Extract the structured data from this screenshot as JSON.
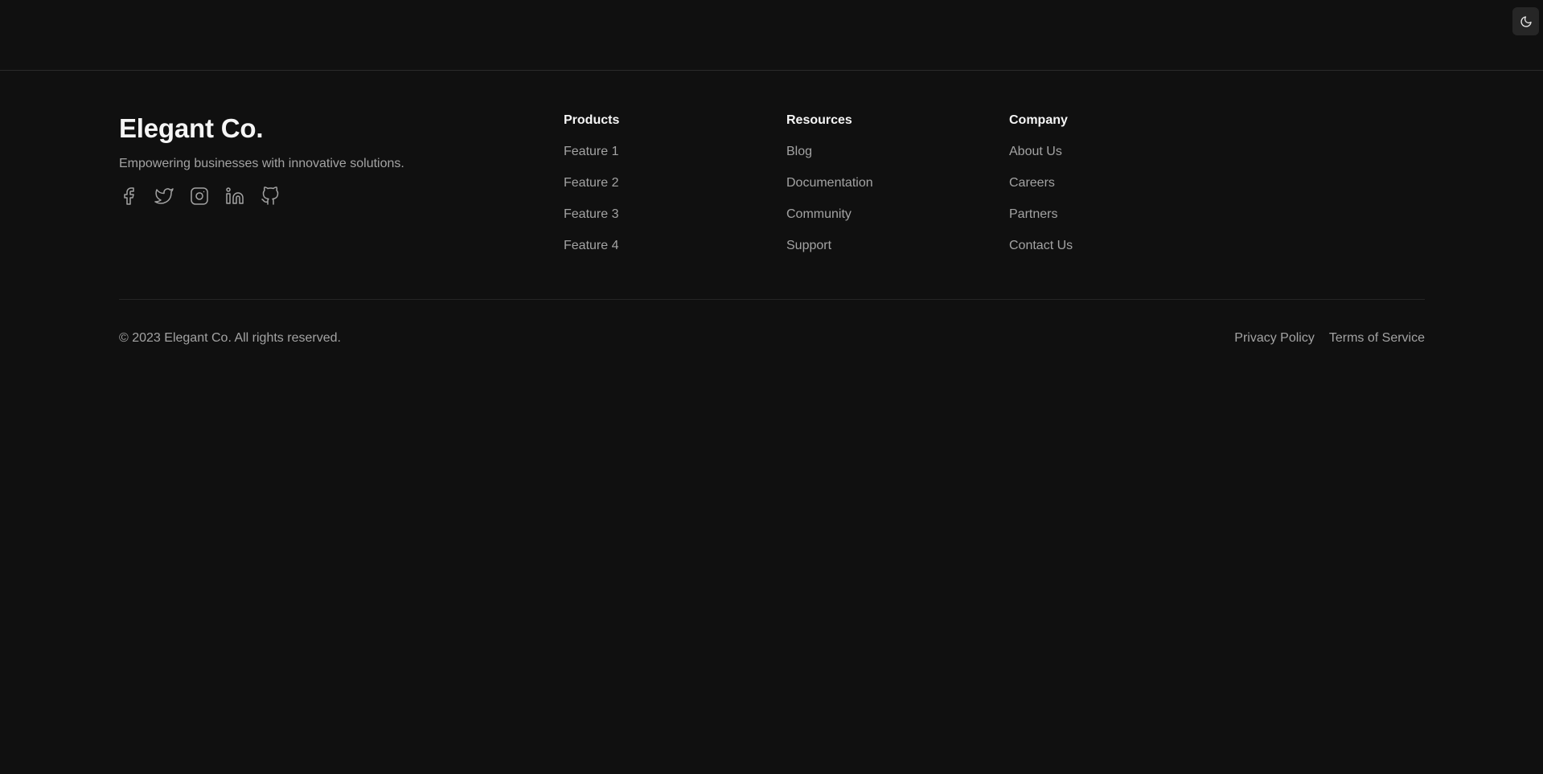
{
  "header": {
    "theme_toggle_icon": "moon-icon"
  },
  "brand": {
    "name": "Elegant Co.",
    "tagline": "Empowering businesses with innovative solutions.",
    "social_icons": [
      "facebook-icon",
      "twitter-icon",
      "instagram-icon",
      "linkedin-icon",
      "github-icon"
    ]
  },
  "columns": [
    {
      "heading": "Products",
      "links": [
        "Feature 1",
        "Feature 2",
        "Feature 3",
        "Feature 4"
      ]
    },
    {
      "heading": "Resources",
      "links": [
        "Blog",
        "Documentation",
        "Community",
        "Support"
      ]
    },
    {
      "heading": "Company",
      "links": [
        "About Us",
        "Careers",
        "Partners",
        "Contact Us"
      ]
    }
  ],
  "bottom": {
    "copyright": "© 2023 Elegant Co. All rights reserved.",
    "privacy": "Privacy Policy",
    "terms": "Terms of Service"
  },
  "colors": {
    "background": "#101010",
    "text_primary": "#f5f5f5",
    "text_muted": "#a3a3a3",
    "border": "#2a2a2a"
  }
}
